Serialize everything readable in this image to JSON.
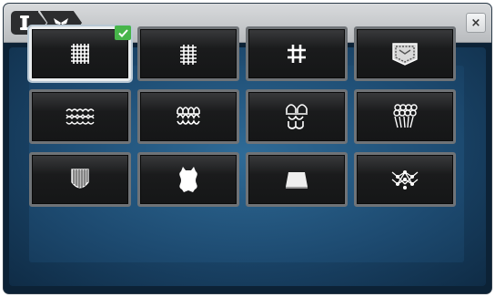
{
  "colors": {
    "accent_selected": "#47b54a",
    "tile_bg": "#1a1b1c",
    "panel": "#1d4a70"
  },
  "breadcrumb": [
    {
      "icon": "bobbin-icon"
    },
    {
      "icon": "butterfly-embroidery-icon"
    }
  ],
  "close_label": "×",
  "tiles": [
    {
      "icon": "woven-fabric-heavy-icon",
      "selected": true
    },
    {
      "icon": "woven-fabric-light-icon",
      "selected": false
    },
    {
      "icon": "woven-fabric-sparse-icon",
      "selected": false
    },
    {
      "icon": "denim-pocket-icon",
      "selected": false
    },
    {
      "icon": "knit-fabric-light-icon",
      "selected": false
    },
    {
      "icon": "knit-fabric-medium-icon",
      "selected": false
    },
    {
      "icon": "knit-fabric-stretch-icon",
      "selected": false
    },
    {
      "icon": "terry-loops-icon",
      "selected": false
    },
    {
      "icon": "pile-fabric-icon",
      "selected": false
    },
    {
      "icon": "leather-hide-icon",
      "selected": false
    },
    {
      "icon": "vinyl-sheet-icon",
      "selected": false
    },
    {
      "icon": "lace-net-icon",
      "selected": false
    }
  ]
}
